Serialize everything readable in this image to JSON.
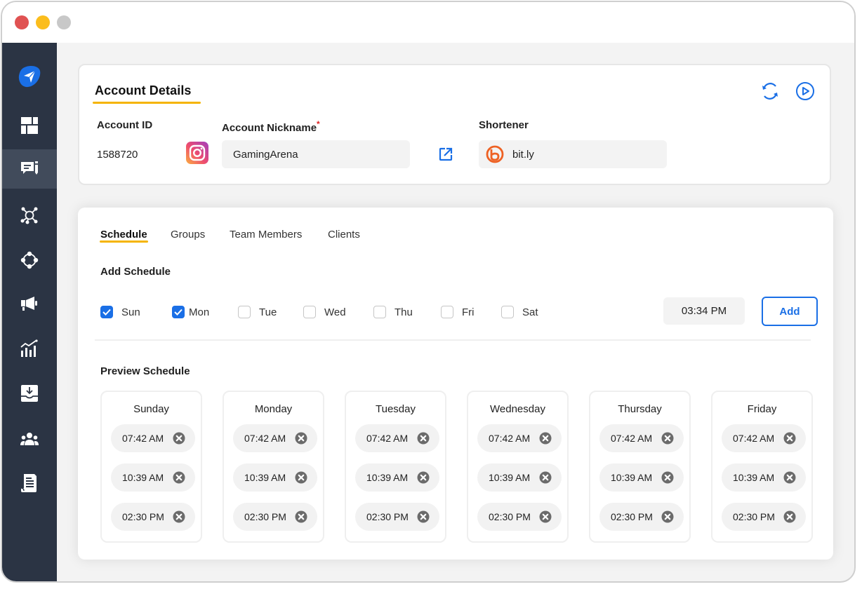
{
  "window": {
    "controls": [
      "close",
      "minimize",
      "maximize"
    ]
  },
  "sidebar": {
    "logo_icon": "paper-plane-icon",
    "items": [
      {
        "name": "dashboard",
        "icon": "grid-icon",
        "active": false
      },
      {
        "name": "messages",
        "icon": "chat-edit-icon",
        "active": true
      },
      {
        "name": "network",
        "icon": "network-icon",
        "active": false
      },
      {
        "name": "connections",
        "icon": "connection-icon",
        "active": false
      },
      {
        "name": "campaigns",
        "icon": "megaphone-icon",
        "active": false
      },
      {
        "name": "analytics",
        "icon": "chart-icon",
        "active": false
      },
      {
        "name": "inbox",
        "icon": "download-tray-icon",
        "active": false
      },
      {
        "name": "team",
        "icon": "users-icon",
        "active": false
      },
      {
        "name": "reports",
        "icon": "document-icon",
        "active": false
      }
    ]
  },
  "account": {
    "title": "Account Details",
    "actions": {
      "refresh": "refresh-icon",
      "play": "play-icon"
    },
    "account_id_label": "Account ID",
    "account_id": "1588720",
    "platform_icon": "instagram-icon",
    "nickname_label": "Account Nickname",
    "nickname_required": "*",
    "nickname_value": "GamingArena",
    "open_link_icon": "external-link-icon",
    "shortener_label": "Shortener",
    "shortener_value": "bit.ly",
    "shortener_icon": "bitly-icon"
  },
  "tabs": [
    {
      "label": "Schedule",
      "active": true
    },
    {
      "label": "Groups",
      "active": false
    },
    {
      "label": "Team Members",
      "active": false
    },
    {
      "label": "Clients",
      "active": false
    }
  ],
  "add_schedule": {
    "title": "Add Schedule",
    "days": [
      {
        "label": "Sun",
        "checked": true
      },
      {
        "label": "Mon",
        "checked": true
      },
      {
        "label": "Tue",
        "checked": false
      },
      {
        "label": "Wed",
        "checked": false
      },
      {
        "label": "Thu",
        "checked": false
      },
      {
        "label": "Fri",
        "checked": false
      },
      {
        "label": "Sat",
        "checked": false
      }
    ],
    "time_value": "03:34 PM",
    "add_label": "Add"
  },
  "preview": {
    "title": "Preview Schedule",
    "days": [
      {
        "name": "Sunday",
        "times": [
          "07:42 AM",
          "10:39 AM",
          "02:30 PM"
        ]
      },
      {
        "name": "Monday",
        "times": [
          "07:42 AM",
          "10:39 AM",
          "02:30 PM"
        ]
      },
      {
        "name": "Tuesday",
        "times": [
          "07:42 AM",
          "10:39 AM",
          "02:30 PM"
        ]
      },
      {
        "name": "Wednesday",
        "times": [
          "07:42 AM",
          "10:39 AM",
          "02:30 PM"
        ]
      },
      {
        "name": "Thursday",
        "times": [
          "07:42 AM",
          "10:39 AM",
          "02:30 PM"
        ]
      },
      {
        "name": "Friday",
        "times": [
          "07:42 AM",
          "10:39 AM",
          "02:30 PM"
        ]
      }
    ]
  },
  "colors": {
    "accent": "#1a6fe6",
    "underline": "#f5b400",
    "sidebar": "#2b3444",
    "sidebar_active": "#414b5b",
    "required": "#e02424",
    "bitly": "#ee6123"
  }
}
